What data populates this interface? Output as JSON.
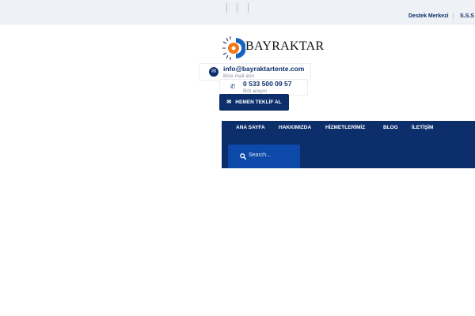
{
  "topbar": {
    "links": [
      "Destek Merkezi",
      "S.S.S"
    ]
  },
  "brand": {
    "name": "BAYRAKTAR",
    "colors": {
      "primary": "#0c2f6b",
      "accent": "#f07a1a",
      "search_bg": "#0d49a8"
    }
  },
  "contacts": {
    "email": {
      "value": "info@bayraktartente.com",
      "caption": "Bize mail atın",
      "icon": "envelope-icon"
    },
    "phone": {
      "value": "0 533 500 09 57",
      "caption": "Bizi arayın",
      "icon": "phone-icon"
    }
  },
  "cta": {
    "label": "HEMEN TEKLİF AL",
    "icon": "envelope-icon"
  },
  "nav": {
    "items": [
      "ANA SAYFA",
      "HAKKIMIZDA",
      "HİZMETLERİMİZ",
      "BLOG",
      "İLETİŞİM"
    ]
  },
  "search": {
    "placeholder": "Search...",
    "icon": "search-icon"
  }
}
